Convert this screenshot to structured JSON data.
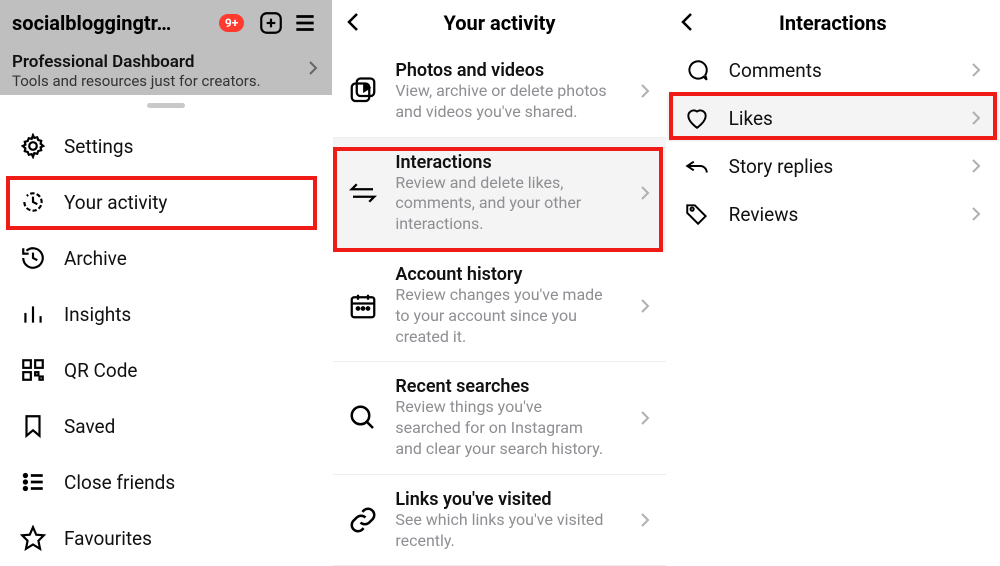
{
  "panel1": {
    "username": "socialbloggingtr…",
    "badge": "9+",
    "dash_title": "Professional Dashboard",
    "dash_sub": "Tools and resources just for creators.",
    "menu": [
      {
        "label": "Settings"
      },
      {
        "label": "Your activity"
      },
      {
        "label": "Archive"
      },
      {
        "label": "Insights"
      },
      {
        "label": "QR Code"
      },
      {
        "label": "Saved"
      },
      {
        "label": "Close friends"
      },
      {
        "label": "Favourites"
      }
    ]
  },
  "panel2": {
    "title": "Your activity",
    "rows": [
      {
        "title": "Photos and videos",
        "sub": "View, archive or delete photos and videos you've shared."
      },
      {
        "title": "Interactions",
        "sub": "Review and delete likes, comments, and your other interactions."
      },
      {
        "title": "Account history",
        "sub": "Review changes you've made to your account since you created it."
      },
      {
        "title": "Recent searches",
        "sub": "Review things you've searched for on Instagram and clear your search history."
      },
      {
        "title": "Links you've visited",
        "sub": "See which links you've visited recently."
      }
    ]
  },
  "panel3": {
    "title": "Interactions",
    "rows": [
      {
        "label": "Comments"
      },
      {
        "label": "Likes"
      },
      {
        "label": "Story replies"
      },
      {
        "label": "Reviews"
      }
    ]
  }
}
